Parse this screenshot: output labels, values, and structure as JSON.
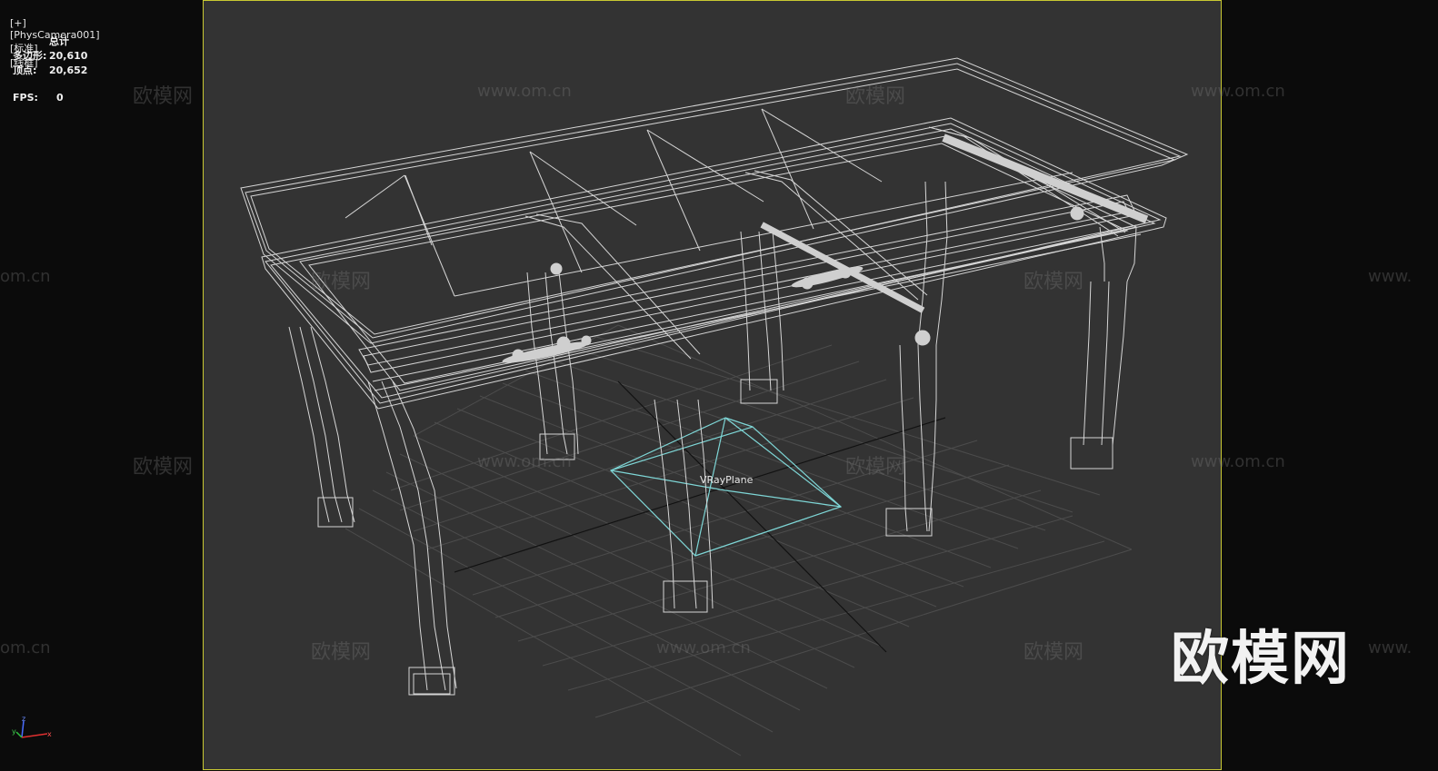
{
  "viewport": {
    "label_parts": [
      "[+]",
      "[PhysCamera001]",
      "[标准]",
      "[线框]"
    ]
  },
  "stats": {
    "header": "总计",
    "polygons_label": "多边形:",
    "polygons_value": "20,610",
    "vertices_label": "顶点:",
    "vertices_value": "20,652",
    "fps_label": "FPS:",
    "fps_value": "0"
  },
  "scene": {
    "object_label": "VRayPlane"
  },
  "watermark": {
    "cn": "欧模网",
    "url": "www.om.cn",
    "url_partial": "om.cn",
    "url_partial_right": "www.",
    "big": "欧模网"
  },
  "axis": {
    "z": "z",
    "y": "y",
    "x": "x"
  },
  "colors": {
    "viewport_bg": "#333333",
    "safe_frame": "#c8c832",
    "wire": "#d6d6d6",
    "grid": "#4a4a4a",
    "plane": "#7ed6d6"
  }
}
